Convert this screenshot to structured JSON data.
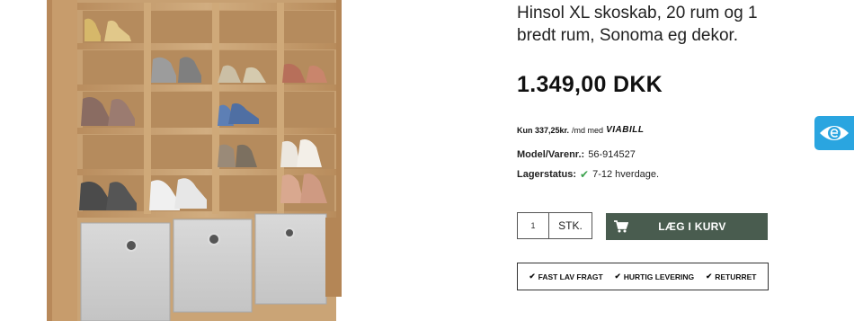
{
  "product": {
    "title": "Hinsol XL skoskab, 20 rum og 1 bredt rum, Sonoma eg dekor.",
    "price": "1.349,00 DKK"
  },
  "viabill": {
    "text": "Kun 337,25kr.",
    "suffix": "/md med",
    "brand": "VIABILL"
  },
  "meta": {
    "model_label": "Model/Varenr.:",
    "model_value": "56-914527",
    "stock_label": "Lagerstatus:",
    "stock_value": "7-12 hverdage."
  },
  "purchase": {
    "quantity": "1",
    "unit": "STK.",
    "add_to_cart": "LÆG I KURV"
  },
  "usps": [
    {
      "label": "FAST LAV FRAGT"
    },
    {
      "label": "HURTIG LEVERING"
    },
    {
      "label": "RETURRET"
    }
  ],
  "colors": {
    "cart_button": "#495c4f",
    "stock_check": "#3aa14c",
    "eye_widget": "#2aa5e0",
    "wood": "#c9a273"
  },
  "icons": {
    "cart": "shopping-cart-icon",
    "check": "check-icon",
    "widget": "eye-icon"
  }
}
